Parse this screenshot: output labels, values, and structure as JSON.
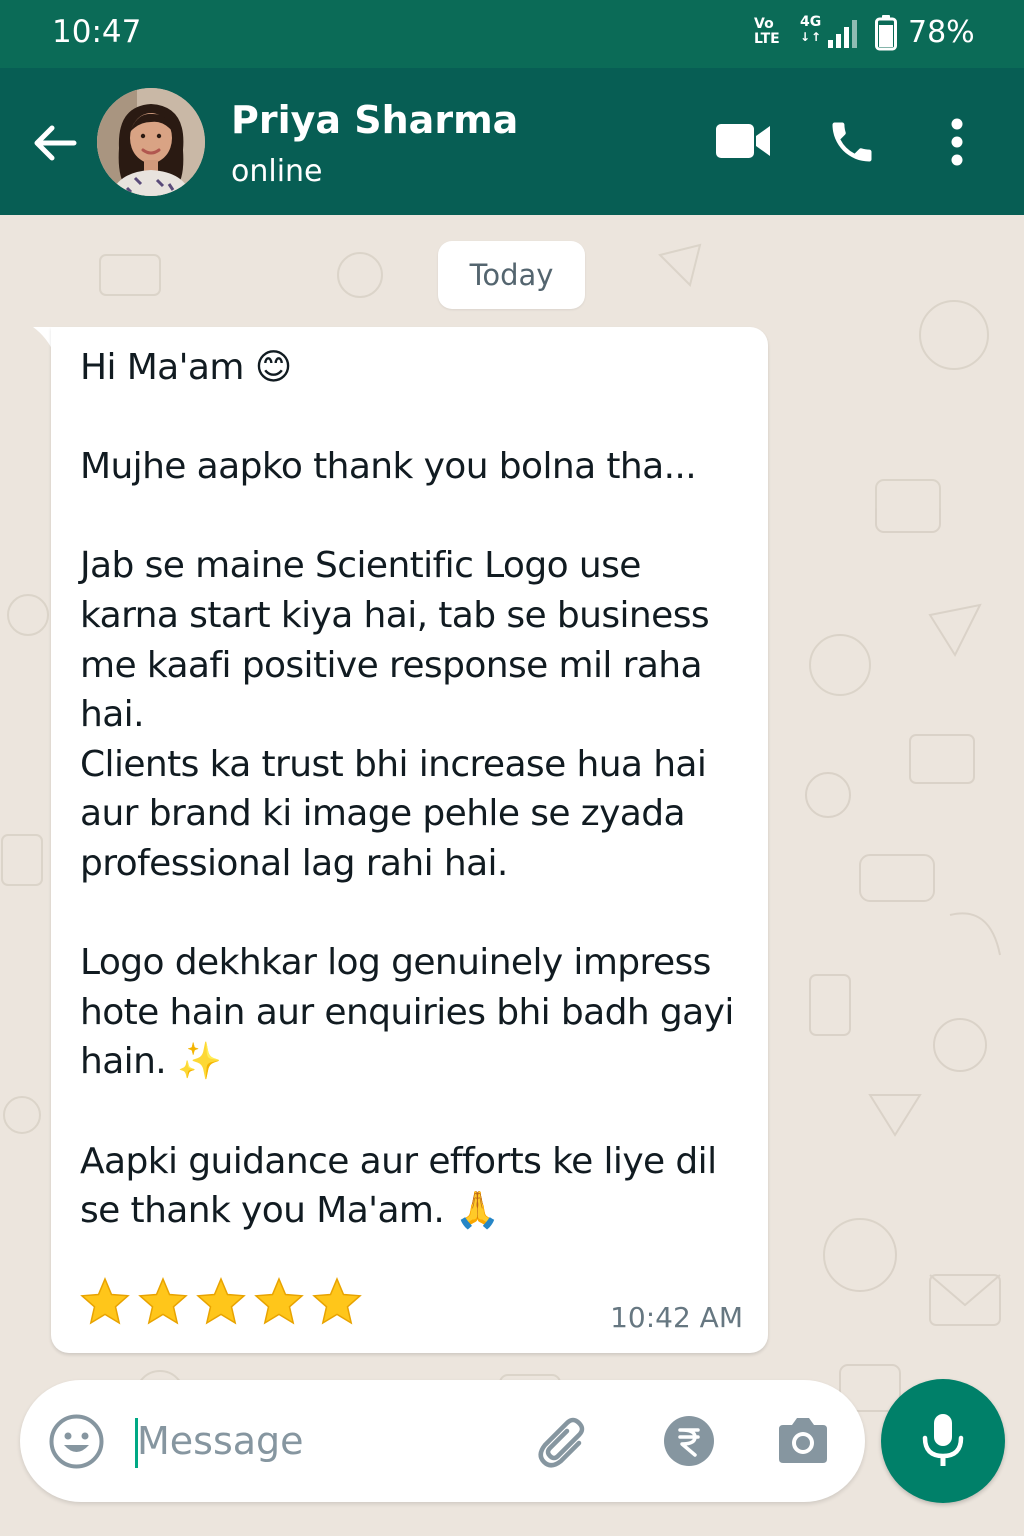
{
  "status_bar": {
    "time": "10:47",
    "volte_top": "Vo",
    "volte_bottom": "LTE",
    "network": "4G",
    "battery": "78%"
  },
  "header": {
    "contact_name": "Priya Sharma",
    "contact_status": "online",
    "icons": [
      "back-arrow-icon",
      "avatar",
      "video-call-icon",
      "voice-call-icon",
      "more-options-icon"
    ]
  },
  "chat": {
    "date_chip": "Today",
    "message": {
      "text": "Hi Ma'am 😊\n\nMujhe aapko thank you bolna tha...\n\nJab se maine Scientific Logo use karna start kiya hai, tab se business me kaafi positive response mil raha hai.\nClients ka trust bhi increase hua hai aur brand ki image pehle se zyada professional lag rahi hai.\n\nLogo dekhkar log genuinely impress hote hain aur enquiries bhi badh gayi hain. ✨\n\nAapki guidance aur efforts ke liye dil se thank you Ma'am. 🙏",
      "rating_stars": 5,
      "time": "10:42 AM"
    }
  },
  "composer": {
    "placeholder": "Message",
    "value": "",
    "icons": [
      "emoji-icon",
      "attach-icon",
      "rupee-payment-icon",
      "camera-icon",
      "mic-icon"
    ]
  },
  "colors": {
    "header": "#075e54",
    "status_bar": "#0b6b57",
    "chat_background": "#ece5dd",
    "bubble": "#ffffff",
    "mic_button": "#008069",
    "accent": "#00a884"
  }
}
